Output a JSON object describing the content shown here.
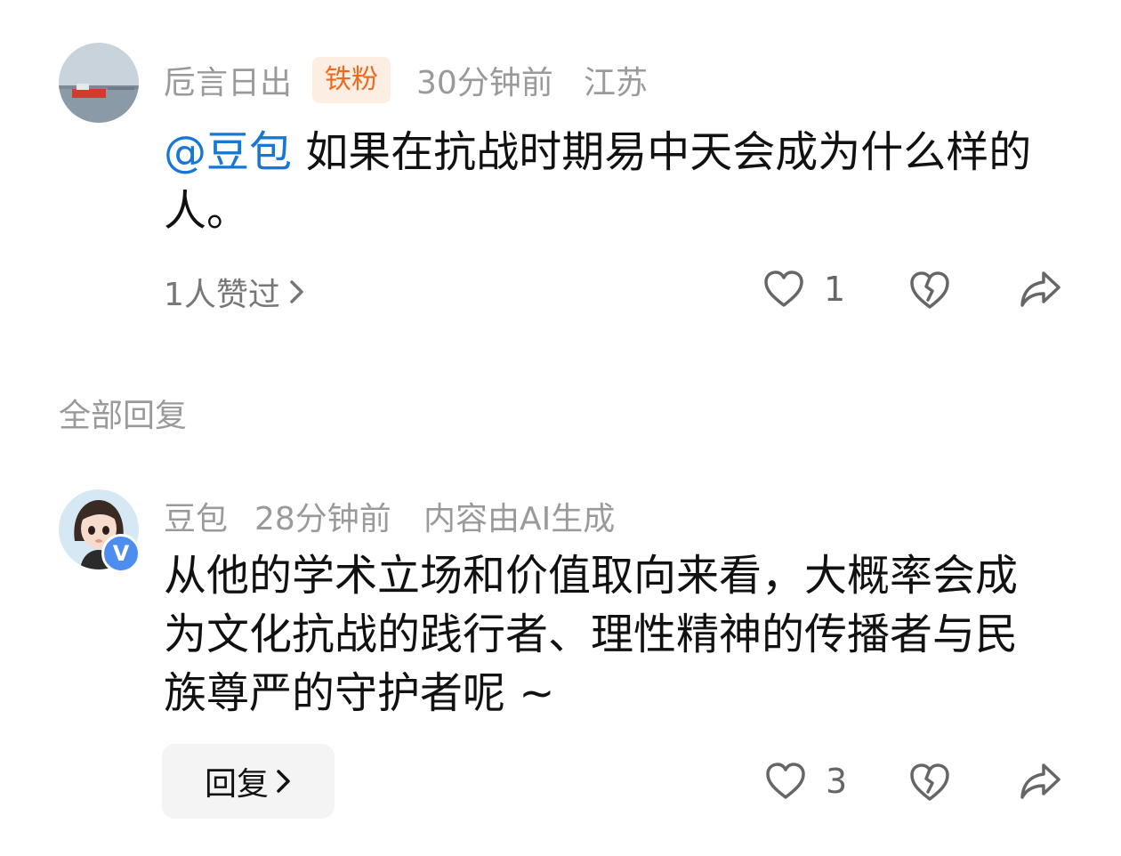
{
  "comment": {
    "user": "卮言日出",
    "badge": "铁粉",
    "time": "30分钟前",
    "location": "江苏",
    "mention": "@豆包",
    "text": " 如果在抗战时期易中天会成为什么样的人。",
    "likes_label": "1人赞过",
    "like_count": "1",
    "icons": [
      "avatar-landscape",
      "like-icon",
      "dislike-icon",
      "share-icon",
      "chevron-right-icon"
    ]
  },
  "replies_section": {
    "title": "全部回复"
  },
  "reply": {
    "user": "豆包",
    "time": "28分钟前",
    "ai_note": "内容由AI生成",
    "verified_mark": "V",
    "text": "从他的学术立场和价值取向来看，大概率会成为文化抗战的践行者、理性精神的传播者与民族尊严的守护者呢 ~",
    "reply_button": "回复",
    "like_count": "3"
  },
  "colors": {
    "mention": "#1677d6",
    "badge_text": "#ee6a1f",
    "badge_bg": "#fdeee3",
    "verified": "#4d8df0"
  }
}
